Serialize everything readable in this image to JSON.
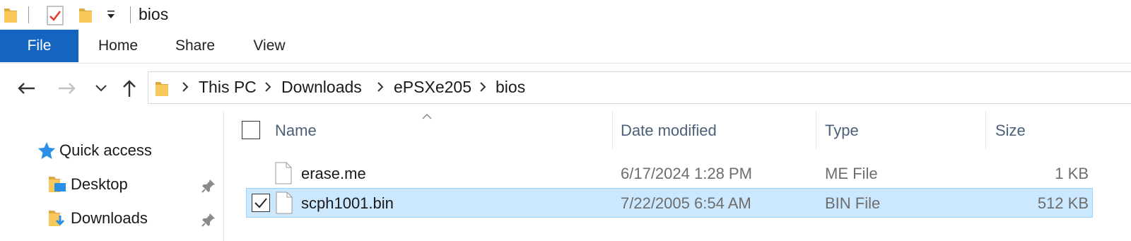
{
  "window": {
    "title": "bios"
  },
  "ribbon": {
    "tabs": {
      "file": "File",
      "home": "Home",
      "share": "Share",
      "view": "View"
    }
  },
  "address": {
    "crumbs": [
      "This PC",
      "Downloads",
      "ePSXe205",
      "bios"
    ]
  },
  "navpane": {
    "quick_access": "Quick access",
    "items": [
      {
        "label": "Desktop",
        "pinned": true
      },
      {
        "label": "Downloads",
        "pinned": true
      }
    ]
  },
  "filelist": {
    "columns": {
      "name": "Name",
      "date": "Date modified",
      "type": "Type",
      "size": "Size"
    },
    "rows": [
      {
        "name": "erase.me",
        "date": "6/17/2024 1:28 PM",
        "type": "ME File",
        "size": "1 KB",
        "selected": false
      },
      {
        "name": "scph1001.bin",
        "date": "7/22/2005 6:54 AM",
        "type": "BIN File",
        "size": "512 KB",
        "selected": true
      }
    ]
  },
  "colors": {
    "accent": "#1565c0",
    "selection": "#cce8ff",
    "folder": "#f8c95a"
  }
}
